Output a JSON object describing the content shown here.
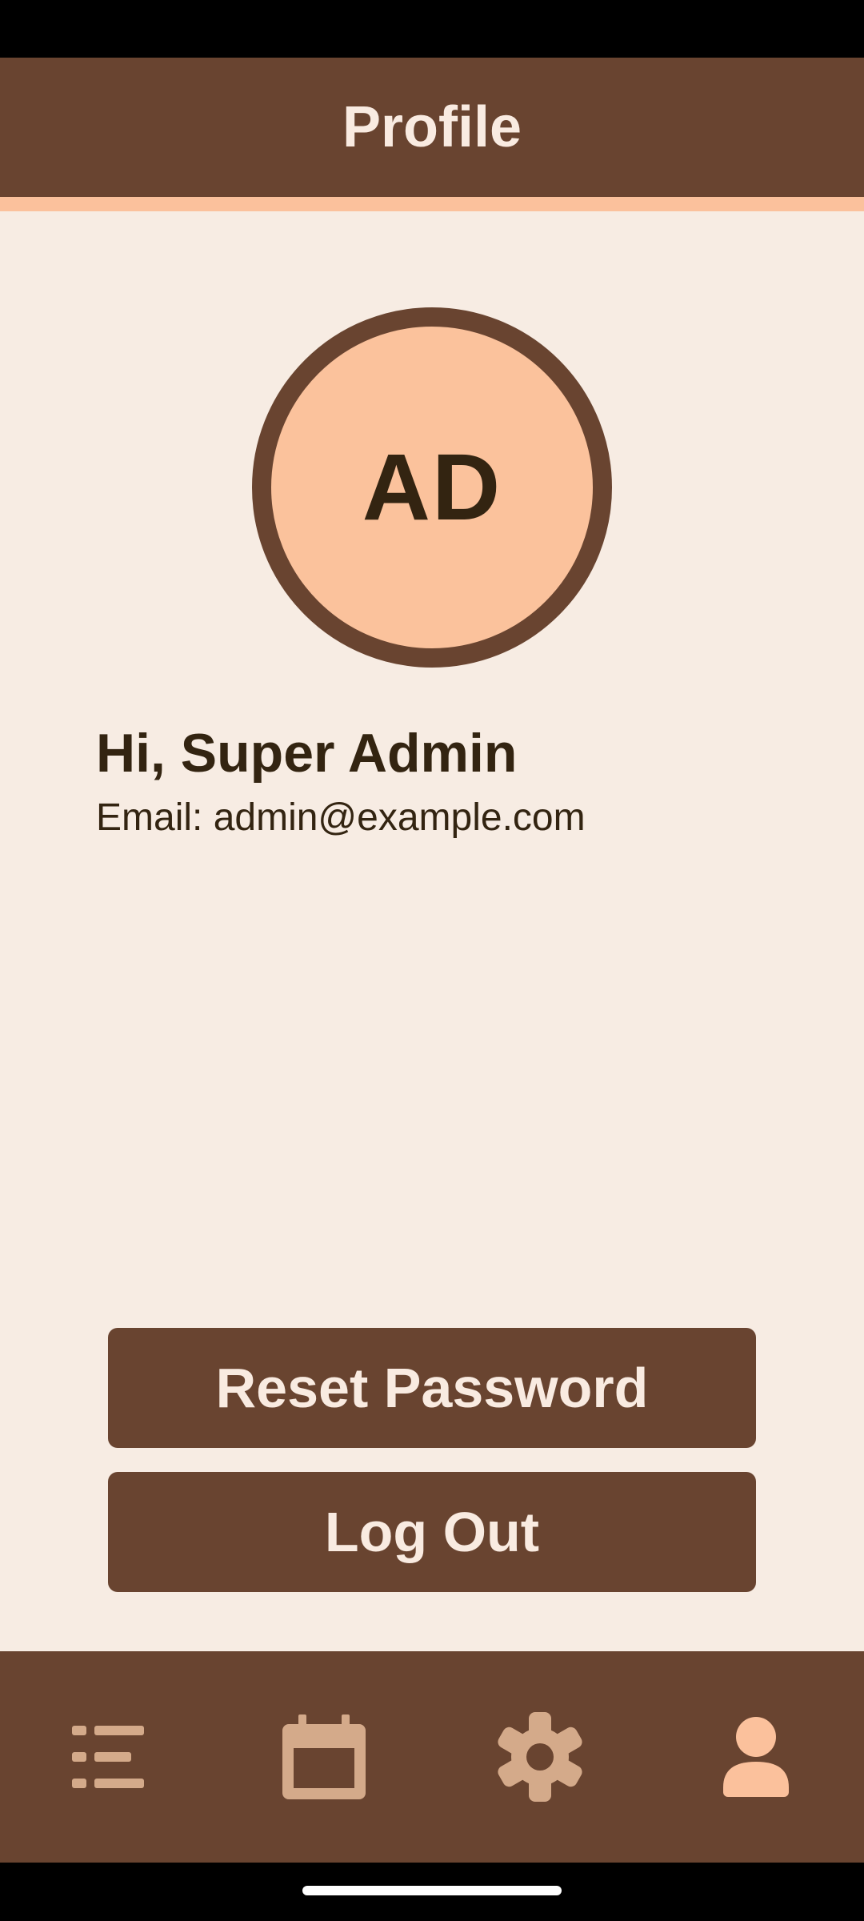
{
  "app_bar": {
    "title": "Profile"
  },
  "profile": {
    "initials": "AD",
    "greeting": "Hi, Super Admin",
    "email_line": "Email: admin@example.com"
  },
  "actions": {
    "reset_password_label": "Reset Password",
    "log_out_label": "Log Out"
  },
  "bottom_nav": {
    "items": [
      {
        "icon": "list-icon",
        "active": false
      },
      {
        "icon": "calendar-icon",
        "active": false
      },
      {
        "icon": "gear-icon",
        "active": false
      },
      {
        "icon": "person-icon",
        "active": true
      }
    ]
  },
  "colors": {
    "primary": "#694430",
    "accent": "#fbc19c",
    "background": "#f7ece3",
    "text_dark": "#332411",
    "nav_inactive": "#d4aa8a",
    "nav_active": "#fbc19c"
  }
}
